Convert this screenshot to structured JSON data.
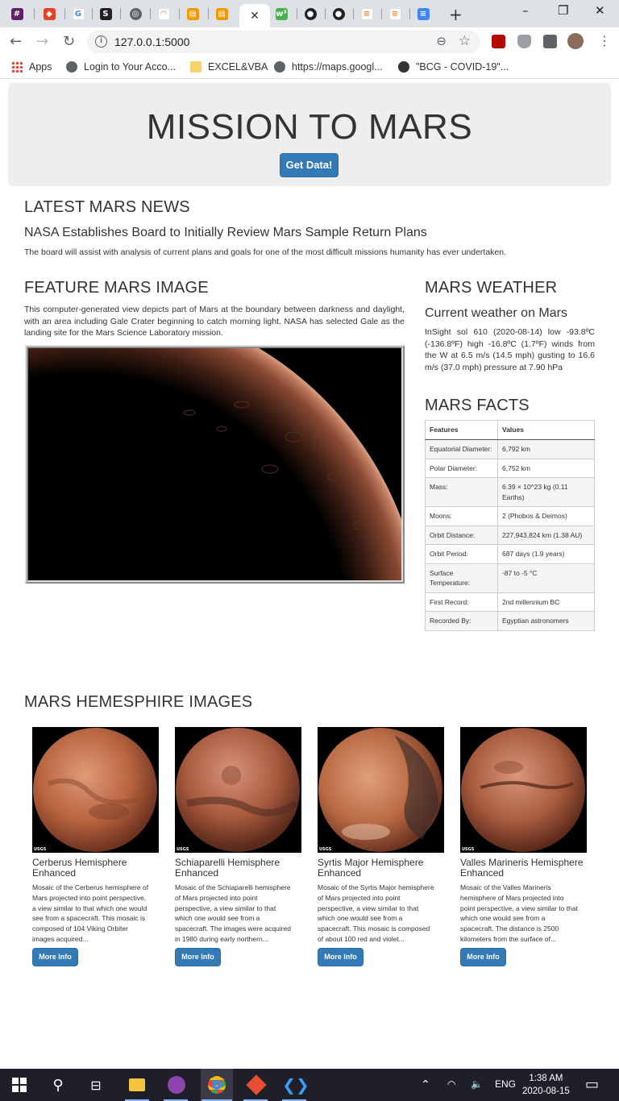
{
  "browser": {
    "tabs_count": 18,
    "url": "127.0.0.1:5000",
    "bookmarks": [
      {
        "label": "Apps",
        "icon": "apps-grid-icon"
      },
      {
        "label": "Login to Your Acco...",
        "icon": "globe-icon"
      },
      {
        "label": "EXCEL&VBA",
        "icon": "folder-icon"
      },
      {
        "label": "https://maps.googl...",
        "icon": "globe-icon"
      },
      {
        "label": "\"BCG - COVID-19\"...",
        "icon": "hbr-icon"
      }
    ]
  },
  "page": {
    "title": "MISSION TO MARS",
    "get_data_label": "Get Data!",
    "news": {
      "heading": "LATEST MARS NEWS",
      "title": "NASA Establishes Board to Initially Review Mars Sample Return Plans",
      "paragraph": "The board will assist with analysis of current plans and goals for one of the most difficult missions humanity has ever undertaken."
    },
    "feature": {
      "heading": "FEATURE MARS IMAGE",
      "description": "This computer-generated view depicts part of Mars at the boundary between darkness and daylight, with an area including Gale Crater beginning to catch morning light. NASA has selected Gale as the landing site for the Mars Science Laboratory mission."
    },
    "weather": {
      "heading": "MARS WEATHER",
      "subheading": "Current weather on Mars",
      "text": "InSight sol 610 (2020-08-14) low -93.8ºC (-136.8ºF) high -16.8ºC (1.7ºF) winds from the W at 6.5 m/s (14.5 mph) gusting to 16.6 m/s (37.0 mph) pressure at 7.90 hPa"
    },
    "facts": {
      "heading": "MARS FACTS",
      "col_features": "Features",
      "col_values": "Values",
      "rows": [
        {
          "feature": "Equatorial Diameter:",
          "value": "6,792 km"
        },
        {
          "feature": "Polar Diameter:",
          "value": "6,752 km"
        },
        {
          "feature": "Mass:",
          "value": "6.39 × 10^23 kg (0.11 Earths)"
        },
        {
          "feature": "Moons:",
          "value": "2 (Phobos & Deimos)"
        },
        {
          "feature": "Orbit Distance:",
          "value": "227,943,824 km (1.38 AU)"
        },
        {
          "feature": "Orbit Period:",
          "value": "687 days (1.9 years)"
        },
        {
          "feature": "Surface Temperature:",
          "value": "-87 to -5 °C"
        },
        {
          "feature": "First Record:",
          "value": "2nd millennium BC"
        },
        {
          "feature": "Recorded By:",
          "value": "Egyptian astronomers"
        }
      ]
    },
    "hemispheres": {
      "heading": "MARS HEMESPHIRE IMAGES",
      "more_info_label": "More Info",
      "items": [
        {
          "title": "Cerberus Hemisphere Enhanced",
          "description": "Mosaic of the Cerberus hemisphere of Mars projected into point perspective, a view similar to that which one would see from a spacecraft. This mosaic is composed of 104 Viking Orbiter images acquired..."
        },
        {
          "title": "Schiaparelli Hemisphere Enhanced",
          "description": "Mosaic of the Schiaparelli hemisphere of Mars projected into point perspective, a view similar to that which one would see from a spacecraft. The images were acquired in 1980 during early northern..."
        },
        {
          "title": "Syrtis Major Hemisphere Enhanced",
          "description": "Mosaic of the Syrtis Major hemisphere of Mars projected into point perspective, a view similar to that which one would see from a spacecraft. This mosaic is composed of about 100 red and violet..."
        },
        {
          "title": "Valles Marineris Hemisphere Enhanced",
          "description": "Mosaic of the Valles Marineris hemisphere of Mars projected into point perspective, a view similar to that which one would see from a spacecraft. The distance is 2500 kilometers from the surface of..."
        }
      ],
      "usgs_label": "USGS"
    }
  },
  "taskbar": {
    "language": "ENG",
    "time": "1:38 AM",
    "date": "2020-08-15"
  },
  "colors": {
    "primary_button": "#337ab7",
    "jumbotron_bg": "#eeeeee"
  }
}
